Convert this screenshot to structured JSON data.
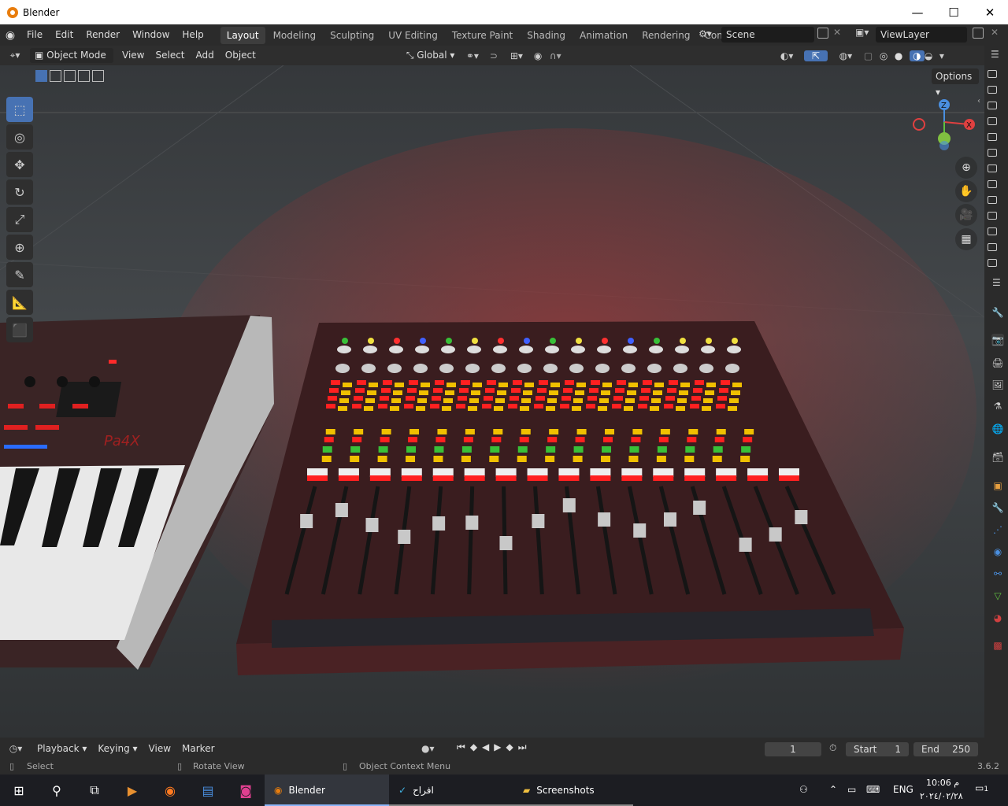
{
  "window": {
    "title": "Blender",
    "min": "—",
    "max": "☐",
    "close": "✕"
  },
  "menu": [
    "File",
    "Edit",
    "Render",
    "Window",
    "Help"
  ],
  "workspaces": [
    "Layout",
    "Modeling",
    "Sculpting",
    "UV Editing",
    "Texture Paint",
    "Shading",
    "Animation",
    "Rendering",
    "Compositing"
  ],
  "active_workspace": "Layout",
  "scene": "Scene",
  "viewlayer": "ViewLayer",
  "header": {
    "mode": "Object Mode",
    "menus": [
      "View",
      "Select",
      "Add",
      "Object"
    ],
    "orientation": "Global",
    "options": "Options"
  },
  "gizmo": {
    "z": "Z",
    "x": "X"
  },
  "timeline": {
    "playback": "Playback",
    "keying": "Keying",
    "view": "View",
    "marker": "Marker",
    "current_frame": "1",
    "start_label": "Start",
    "start": "1",
    "end_label": "End",
    "end": "250"
  },
  "status": {
    "select": "Select",
    "rotate": "Rotate View",
    "context": "Object Context Menu",
    "version": "3.6.2"
  },
  "taskbar": {
    "apps": [
      "Blender",
      "افراح",
      "Screenshots"
    ],
    "lang": "ENG",
    "time": "10:06 م",
    "date": "٢٠٢٤/٠٢/٢٨",
    "notif": "1"
  },
  "scene_labels": {
    "keyboard_brand": "Pa4X"
  },
  "colors": {
    "accent": "#4772b3",
    "blender_orange": "#e87d0d",
    "led_red": "#ff2020",
    "led_yellow": "#f0c000",
    "led_green": "#38c038"
  }
}
